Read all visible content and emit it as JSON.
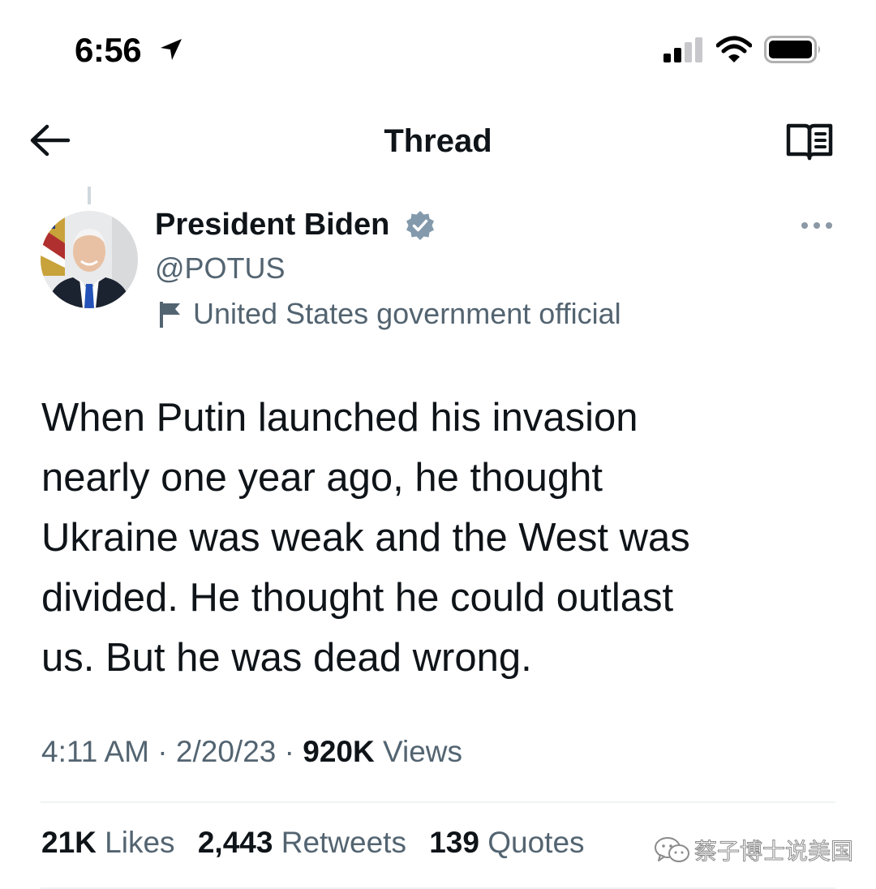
{
  "status_bar": {
    "time": "6:56",
    "icons": [
      "location-arrow-icon",
      "cellular-signal-icon",
      "wifi-icon",
      "battery-icon"
    ]
  },
  "nav": {
    "title": "Thread",
    "back_icon": "back-arrow-icon",
    "reader_icon": "reader-mode-icon"
  },
  "tweet": {
    "author": {
      "display_name": "President Biden",
      "handle": "@POTUS",
      "verified": true,
      "label": "United States government official"
    },
    "text": "When Putin launched his invasion\nnearly one year ago, he thought\nUkraine was weak and the West was\ndivided.  He thought he could outlast\nus. But he was dead wrong.",
    "meta": {
      "time": "4:11 AM",
      "date": "2/20/23",
      "separator": "·",
      "views_count": "920K",
      "views_label": "Views"
    },
    "stats": [
      {
        "count": "21K",
        "label": "Likes"
      },
      {
        "count": "2,443",
        "label": "Retweets"
      },
      {
        "count": "139",
        "label": "Quotes"
      }
    ]
  },
  "watermark": {
    "text": "蔡子博士说美国",
    "icon": "wechat-icon"
  },
  "colors": {
    "text_primary": "#0f1419",
    "text_secondary": "#536471",
    "verified_badge": "#829aab",
    "divider": "#eff3f4"
  }
}
